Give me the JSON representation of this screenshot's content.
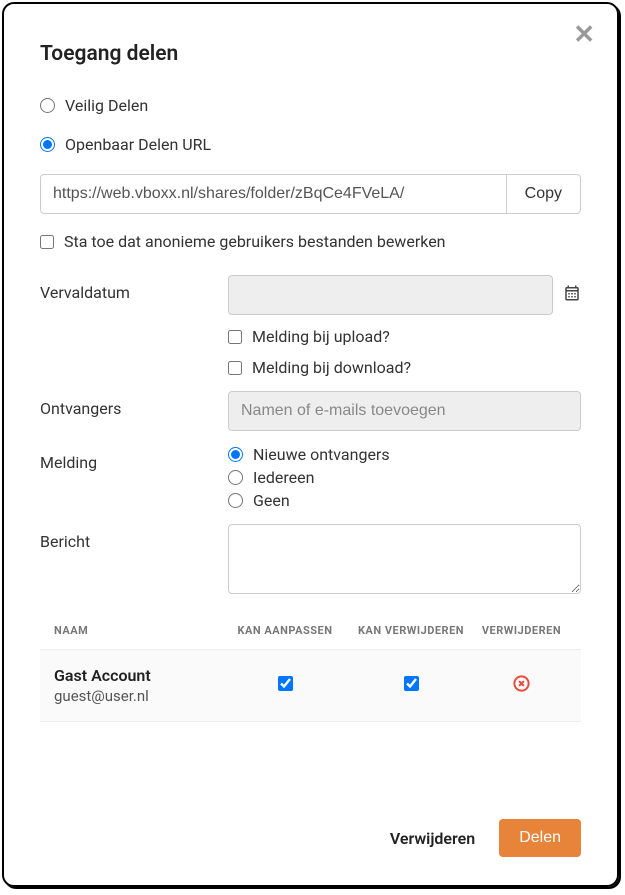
{
  "title": "Toegang delen",
  "shareType": {
    "secure": "Veilig Delen",
    "public": "Openbaar Delen URL"
  },
  "url": "https://web.vboxx.nl/shares/folder/zBqCe4FVeLA/",
  "copyLabel": "Copy",
  "anonEdit": "Sta toe dat anonieme gebruikers bestanden bewerken",
  "expiry": {
    "label": "Vervaldatum",
    "notifyUpload": "Melding bij upload?",
    "notifyDownload": "Melding bij download?"
  },
  "recipients": {
    "label": "Ontvangers",
    "placeholder": "Namen of e-mails toevoegen"
  },
  "notification": {
    "label": "Melding",
    "newRecipients": "Nieuwe ontvangers",
    "everyone": "Iedereen",
    "none": "Geen"
  },
  "message": {
    "label": "Bericht"
  },
  "table": {
    "headers": {
      "name": "NAAM",
      "canEdit": "KAN AANPASSEN",
      "canDelete": "KAN VERWIJDEREN",
      "remove": "VERWIJDEREN"
    },
    "rows": [
      {
        "name": "Gast Account",
        "email": "guest@user.nl",
        "canEdit": true,
        "canDelete": true
      }
    ]
  },
  "footer": {
    "remove": "Verwijderen",
    "share": "Delen"
  }
}
